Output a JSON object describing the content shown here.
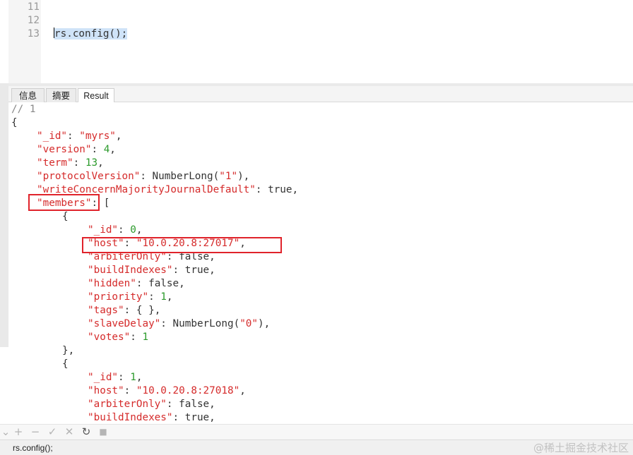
{
  "editor": {
    "line_numbers": [
      "11",
      "12",
      "13"
    ],
    "line_13_code": "rs.config();"
  },
  "tabs": [
    {
      "label": "信息"
    },
    {
      "label": "摘要"
    },
    {
      "label": "Result"
    }
  ],
  "result": {
    "lines": [
      {
        "t": "comment",
        "text": "// 1"
      },
      {
        "t": "brace",
        "text": "{"
      },
      {
        "t": "kv",
        "key": "\"_id\"",
        "sep": ": ",
        "val": "\"myrs\"",
        "vt": "s",
        "tail": ","
      },
      {
        "t": "kv",
        "key": "\"version\"",
        "sep": ": ",
        "val": "4",
        "vt": "n",
        "tail": ","
      },
      {
        "t": "kv",
        "key": "\"term\"",
        "sep": ": ",
        "val": "13",
        "vt": "n",
        "tail": ","
      },
      {
        "t": "kv",
        "key": "\"protocolVersion\"",
        "sep": ": ",
        "val": "NumberLong(",
        "vt": "p",
        "val2": "\"1\"",
        "tail": "),"
      },
      {
        "t": "kv",
        "key": "\"writeConcernMajorityJournalDefault\"",
        "sep": ": ",
        "val": "true",
        "vt": "p",
        "tail": ","
      },
      {
        "t": "kv",
        "key": "\"members\"",
        "sep": ": ",
        "val": "[",
        "vt": "p",
        "tail": ""
      },
      {
        "t": "brace",
        "text": "{"
      },
      {
        "t": "kv",
        "key": "\"_id\"",
        "sep": ": ",
        "val": "0",
        "vt": "n",
        "tail": ","
      },
      {
        "t": "kv",
        "key": "\"host\"",
        "sep": ": ",
        "val": "\"10.0.20.8:27017\"",
        "vt": "s",
        "tail": ","
      },
      {
        "t": "kv",
        "key": "\"arbiterOnly\"",
        "sep": ": ",
        "val": "false",
        "vt": "p",
        "tail": ","
      },
      {
        "t": "kv",
        "key": "\"buildIndexes\"",
        "sep": ": ",
        "val": "true",
        "vt": "p",
        "tail": ","
      },
      {
        "t": "kv",
        "key": "\"hidden\"",
        "sep": ": ",
        "val": "false",
        "vt": "p",
        "tail": ","
      },
      {
        "t": "kv",
        "key": "\"priority\"",
        "sep": ": ",
        "val": "1",
        "vt": "n",
        "tail": ","
      },
      {
        "t": "kv",
        "key": "\"tags\"",
        "sep": ": ",
        "val": "{ }",
        "vt": "p",
        "tail": ","
      },
      {
        "t": "kv",
        "key": "\"slaveDelay\"",
        "sep": ": ",
        "val": "NumberLong(",
        "vt": "p",
        "val2": "\"0\"",
        "tail": "),"
      },
      {
        "t": "kv",
        "key": "\"votes\"",
        "sep": ": ",
        "val": "1",
        "vt": "n",
        "tail": ""
      },
      {
        "t": "brace",
        "text": "},"
      },
      {
        "t": "brace",
        "text": "{"
      },
      {
        "t": "kv",
        "key": "\"_id\"",
        "sep": ": ",
        "val": "1",
        "vt": "n",
        "tail": ","
      },
      {
        "t": "kv",
        "key": "\"host\"",
        "sep": ": ",
        "val": "\"10.0.20.8:27018\"",
        "vt": "s",
        "tail": ","
      },
      {
        "t": "kv",
        "key": "\"arbiterOnly\"",
        "sep": ": ",
        "val": "false",
        "vt": "p",
        "tail": ","
      },
      {
        "t": "kv",
        "key": "\"buildIndexes\"",
        "sep": ": ",
        "val": "true",
        "vt": "p",
        "tail": ","
      }
    ]
  },
  "toolbar": {
    "icons": [
      "chevron-down-icon",
      "plus-icon",
      "minus-icon",
      "check-icon",
      "close-icon",
      "refresh-icon",
      "stop-icon"
    ],
    "glyphs": [
      "⌄",
      "+",
      "−",
      "✓",
      "✕",
      "↻",
      "■"
    ]
  },
  "status": {
    "query_text": "rs.config();",
    "watermark": "@稀土掘金技术社区"
  },
  "colors": {
    "key": "#d52b2b",
    "number": "#2b9a2b",
    "highlight_box": "#e0232b",
    "selection": "#cfe3f8"
  }
}
